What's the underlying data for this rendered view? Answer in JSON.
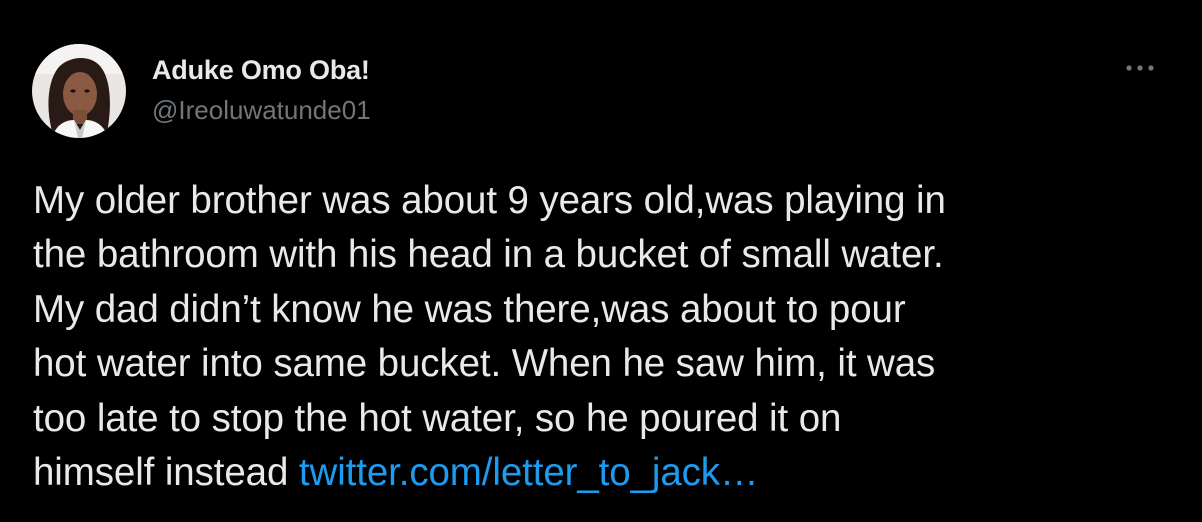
{
  "tweet": {
    "author": {
      "display_name": "Aduke Omo Oba!",
      "handle": "@Ireoluwatunde01",
      "avatar_icon": "profile-photo"
    },
    "more_icon": "more-options-icon",
    "body_lines": [
      "My older brother was about 9 years old,was playing in",
      "the bathroom with his head in a bucket of small water.",
      "My dad didn’t know he was there,was about to pour",
      "hot water into same bucket. When he saw him, it was",
      "too late to stop the hot water, so he poured it on",
      "himself instead "
    ],
    "link_text": "twitter.com/letter_to_jack…"
  },
  "colors": {
    "background": "#000000",
    "text_primary": "#e7e9ea",
    "text_secondary": "#71767b",
    "link": "#1d9bf0"
  }
}
